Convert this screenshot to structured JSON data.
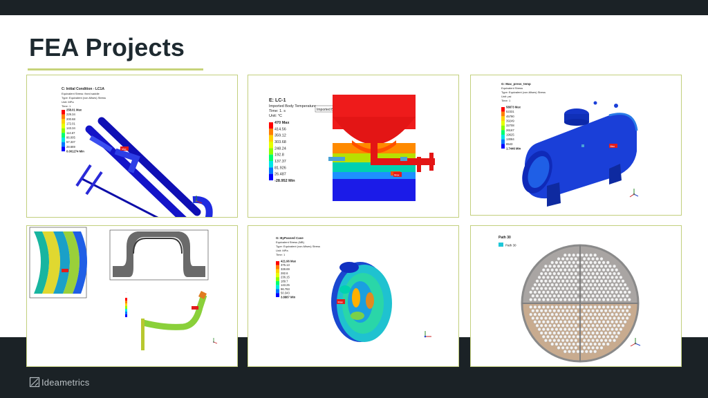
{
  "slide": {
    "title": "FEA Projects"
  },
  "brand": {
    "name": "Ideametrics"
  },
  "panels": {
    "p1": {
      "title": "C: Initial Condition - LC1A",
      "info": [
        "Equivalent Stress: fixed saddle",
        "Type: Equivalent (von-Mises) Stress",
        "Unit: MPa",
        "Time: 1"
      ],
      "max_label": "258.01 Max",
      "ticks": [
        "229.34",
        "200.68",
        "172.01",
        "143.34",
        "114.67",
        "86.005",
        "57.337",
        "28.669"
      ],
      "min_label": "0.001274 Min",
      "marker": "Max"
    },
    "p2": {
      "title": "E: LC-1",
      "info": [
        "Imported Body Temperature",
        "Time: 1. s",
        "Unit: °C"
      ],
      "tooltip": "Imported Body Temperature",
      "max_label": "470 Max",
      "ticks": [
        "414.56",
        "359.12",
        "303.68",
        "248.24",
        "192.8",
        "137.37",
        "81.926",
        "26.487"
      ],
      "min_label": "-28.952 Min",
      "marker": "Max"
    },
    "p3": {
      "title": "G: Max_press_temp",
      "info": [
        "Equivalent Stress",
        "Type: Equivalent (von-Mises) Stress",
        "Unit: psi",
        "Time: 1"
      ],
      "max_label": "58873 Max",
      "ticks": [
        "52331",
        "45790",
        "39249",
        "32708",
        "26167",
        "19625",
        "13084",
        "6543"
      ],
      "min_label": "1.7446 Min",
      "marker": "Max"
    },
    "p5": {
      "title": "G: ByPassed Case",
      "info": [
        "Equivalent Stress (MB)",
        "Type: Equivalent (von-Mises) Stress",
        "Unit: MPa",
        "Time: 1"
      ],
      "max_label": "421.96 Max",
      "ticks": [
        "375.13",
        "328.69",
        "282.6",
        "236.15",
        "189.7",
        "143.25",
        "96.793",
        "50.343"
      ],
      "min_label": "3.8887 Min",
      "marker": "Max"
    },
    "p6": {
      "title": "Path 30",
      "legend_item": "Path 30"
    }
  },
  "colors": {
    "frame": "#c2cf7c",
    "dark": "#1b2226",
    "accent_rule": "#c7d37a",
    "contour": [
      "#ff0000",
      "#ff7f00",
      "#ffd200",
      "#e6ff00",
      "#8cff00",
      "#00ff6e",
      "#00e6e6",
      "#0078ff",
      "#0000ff"
    ]
  }
}
